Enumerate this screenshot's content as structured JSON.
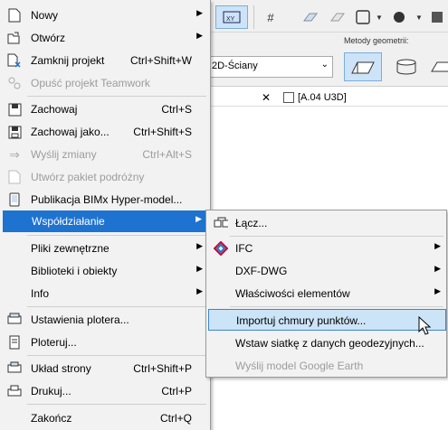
{
  "background": {
    "geometry_label": "Metody geometrii:",
    "combo_value": "2D-Ściany",
    "tab_label": "[A.04 U3D]"
  },
  "menu": {
    "items": [
      {
        "label": "Nowy",
        "submenu": true
      },
      {
        "label": "Otwórz",
        "submenu": true
      },
      {
        "label": "Zamknij projekt",
        "shortcut": "Ctrl+Shift+W"
      },
      {
        "label": "Opuść projekt Teamwork",
        "disabled": true
      },
      {
        "label": "Zachowaj",
        "shortcut": "Ctrl+S"
      },
      {
        "label": "Zachowaj jako...",
        "shortcut": "Ctrl+Shift+S"
      },
      {
        "label": "Wyślij zmiany",
        "shortcut": "Ctrl+Alt+S",
        "disabled": true
      },
      {
        "label": "Utwórz pakiet podróżny",
        "disabled": true
      },
      {
        "label": "Publikacja BIMx Hyper-model..."
      },
      {
        "label": "Współdziałanie",
        "submenu": true,
        "highlighted": true
      },
      {
        "label": "Pliki zewnętrzne",
        "submenu": true
      },
      {
        "label": "Biblioteki i obiekty",
        "submenu": true
      },
      {
        "label": "Info",
        "submenu": true
      },
      {
        "label": "Ustawienia plotera..."
      },
      {
        "label": "Ploteruj..."
      },
      {
        "label": "Układ strony",
        "shortcut": "Ctrl+Shift+P"
      },
      {
        "label": "Drukuj...",
        "shortcut": "Ctrl+P"
      },
      {
        "label": "Zakończ",
        "shortcut": "Ctrl+Q"
      }
    ]
  },
  "submenu": {
    "items": [
      {
        "label": "Łącz..."
      },
      {
        "label": "IFC",
        "submenu": true
      },
      {
        "label": "DXF-DWG",
        "submenu": true
      },
      {
        "label": "Właściwości elementów",
        "submenu": true
      },
      {
        "label": "Importuj chmury punktów...",
        "hovered": true
      },
      {
        "label": "Wstaw siatkę z danych geodezyjnych..."
      },
      {
        "label": "Wyślij model Google Earth",
        "disabled": true
      }
    ]
  },
  "colors": {
    "highlight": "#1e73d0",
    "hover": "#cce4f7",
    "disabled_text": "#9c9c9c"
  }
}
